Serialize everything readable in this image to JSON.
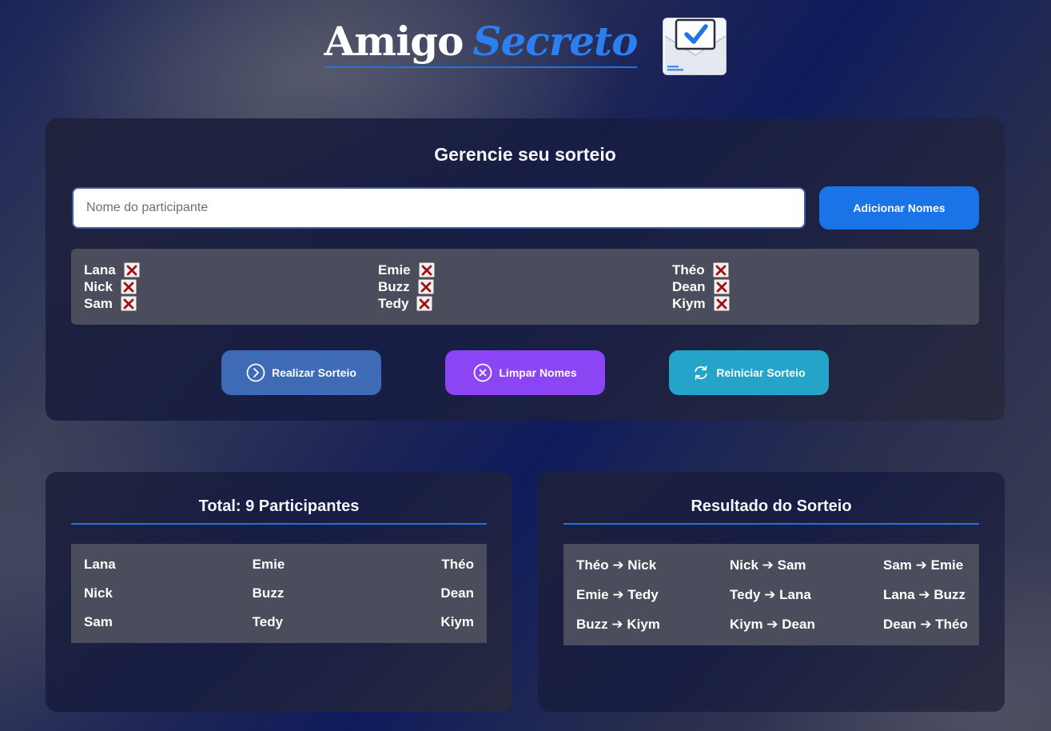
{
  "header": {
    "title_part1": "Amigo",
    "title_part2": "Secreto",
    "logo_icon": "envelope-check-icon"
  },
  "manage": {
    "title": "Gerencie seu sorteio",
    "input_placeholder": "Nome do participante",
    "input_value": "",
    "add_button": "Adicionar Nomes",
    "participants": [
      [
        "Lana",
        "Nick",
        "Sam"
      ],
      [
        "Emie",
        "Buzz",
        "Tedy"
      ],
      [
        "Théo",
        "Dean",
        "Kiym"
      ]
    ],
    "remove_icon": "close-x-icon",
    "buttons": {
      "draw": "Realizar Sorteio",
      "clear": "Limpar Nomes",
      "reset": "Reiniciar Sorteio"
    }
  },
  "total": {
    "title": "Total: 9 Participantes",
    "rows": [
      [
        "Lana",
        "Emie",
        "Théo"
      ],
      [
        "Nick",
        "Buzz",
        "Dean"
      ],
      [
        "Sam",
        "Tedy",
        "Kiym"
      ]
    ]
  },
  "result": {
    "title": "Resultado do Sorteio",
    "rows": [
      [
        "Théo ➔ Nick",
        "Nick ➔ Sam",
        "Sam ➔ Emie"
      ],
      [
        "Emie ➔ Tedy",
        "Tedy ➔ Lana",
        "Lana ➔ Buzz"
      ],
      [
        "Buzz ➔ Kiym",
        "Kiym ➔ Dean",
        "Dean ➔ Théo"
      ]
    ]
  },
  "colors": {
    "accent": "#1b73e8",
    "draw_button": "#3f6ab5",
    "clear_button": "#8b45f4",
    "reset_button": "#25a4c9",
    "list_background": "#4b4d5c"
  }
}
